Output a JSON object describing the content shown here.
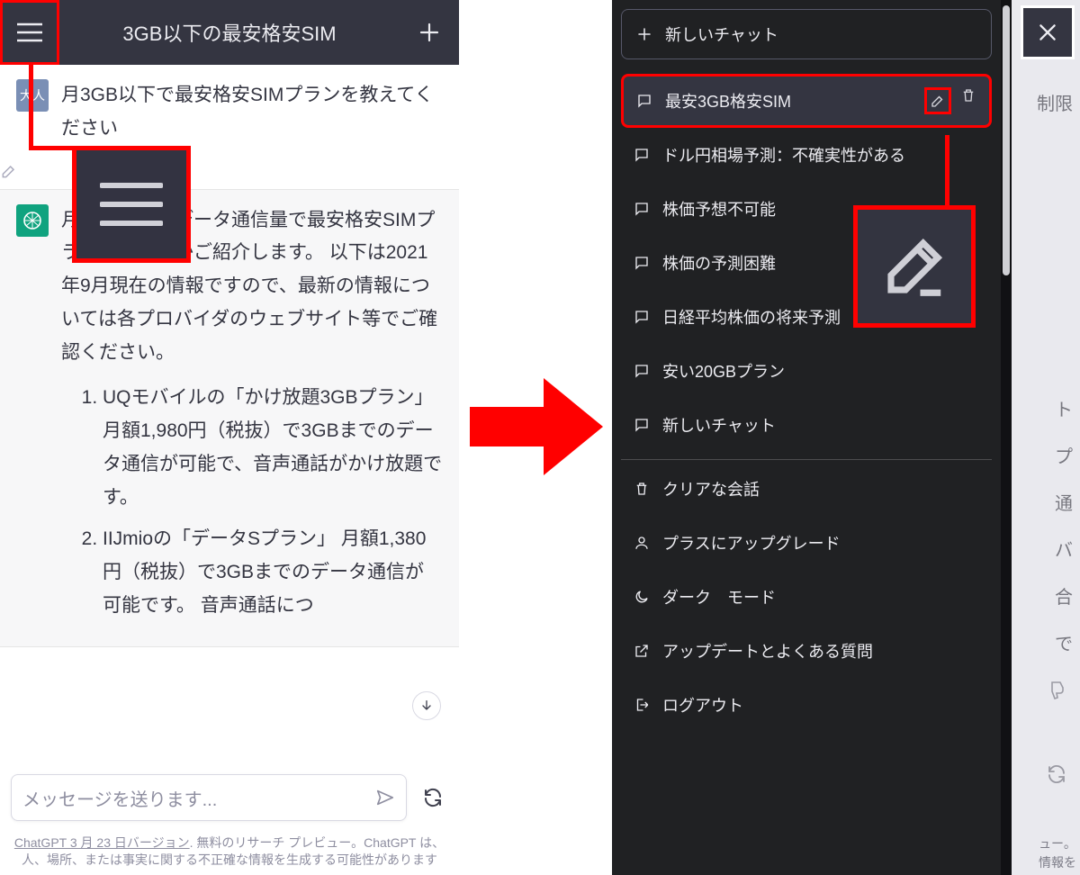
{
  "left": {
    "header_title": "3GB以下の最安格安SIM",
    "user_avatar": "大人",
    "user_message": "月3GB以下で最安格安SIMプランを教えてください",
    "assistant_intro": "月3GB以下のデータ通信量で最安格安SIMプランをいくつかご紹介します。 以下は2021年9月現在の情報ですので、最新の情報については各プロバイダのウェブサイト等でご確認ください。",
    "assistant_items": [
      "UQモバイルの「かけ放題3GBプラン」 月額1,980円（税抜）で3GBまでのデータ通信が可能で、音声通話がかけ放題です。",
      "IIJmioの「データSプラン」 月額1,380円（税抜）で3GBまでのデータ通信が可能です。 音声通話につ"
    ],
    "input_placeholder": "メッセージを送ります...",
    "footer_version": "ChatGPT 3 月 23 日バージョン",
    "footer_rest": ". 無料のリサーチ プレビュー。ChatGPT は、人、場所、または事実に関する不正確な情報を生成する可能性があります"
  },
  "right": {
    "new_chat": "新しいチャット",
    "chats": [
      "最安3GB格安SIM",
      "ドル円相場予測：不確実性がある",
      "株価予想不可能",
      "株価の予測困難",
      "日経平均株価の将来予測",
      "安い20GBプラン",
      "新しいチャット"
    ],
    "menu": {
      "clear": "クリアな会話",
      "upgrade": "プラスにアップグレード",
      "dark": "ダーク　モード",
      "faq": "アップデートとよくある質問",
      "logout": "ログアウト"
    },
    "dim_header": "制限",
    "dim_lines": "ト\nプ\n通\nバ\n合\nで",
    "dim_footer": "ュー。\n情報を"
  }
}
